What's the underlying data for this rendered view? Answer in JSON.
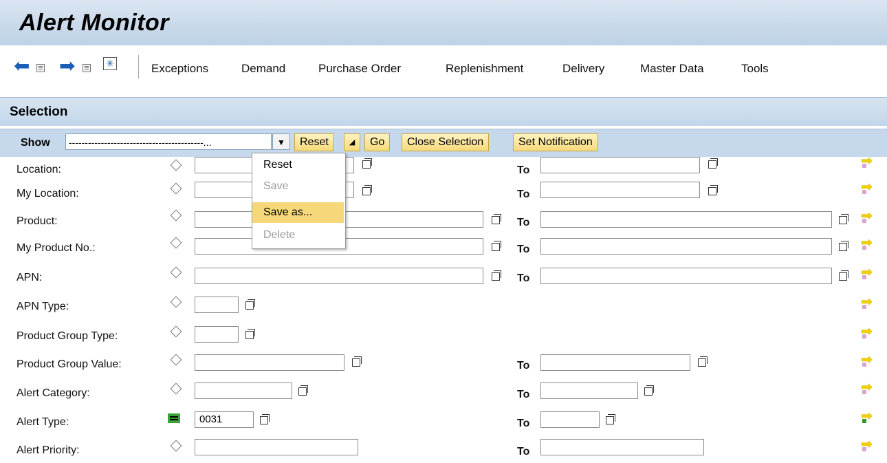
{
  "app": {
    "title": "Alert Monitor"
  },
  "nav": {
    "icons": [
      "back-arrow-icon",
      "history-list-icon",
      "forward-arrow-icon",
      "history-list-icon",
      "favorites-star-icon"
    ],
    "menu": [
      "Exceptions",
      "Demand",
      "Purchase Order",
      "Replenishment",
      "Delivery",
      "Master Data",
      "Tools"
    ]
  },
  "selection": {
    "title": "Selection",
    "show_label": "Show",
    "show_value": "------------------------------------------...",
    "buttons": {
      "reset": "Reset",
      "go": "Go",
      "close_selection": "Close Selection",
      "set_notification": "Set Notification"
    }
  },
  "context_menu": {
    "items": [
      {
        "label": "Reset",
        "enabled": true,
        "highlighted": false
      },
      {
        "label": "Save",
        "enabled": false,
        "highlighted": false
      },
      {
        "label": "Save as...",
        "enabled": true,
        "highlighted": true
      },
      {
        "label": "Delete",
        "enabled": false,
        "highlighted": false
      }
    ]
  },
  "to_label": "To",
  "rows": [
    {
      "label": "Location:",
      "value": "",
      "to_value": ""
    },
    {
      "label": "My Location:",
      "value": "",
      "to_value": ""
    },
    {
      "label": "Product:",
      "value": "",
      "to_value": ""
    },
    {
      "label": "My Product No.:",
      "value": "",
      "to_value": ""
    },
    {
      "label": "APN:",
      "value": "",
      "to_value": ""
    },
    {
      "label": "APN Type:",
      "value": ""
    },
    {
      "label": "Product Group Type:",
      "value": ""
    },
    {
      "label": "Product Group Value:",
      "value": "",
      "to_value": ""
    },
    {
      "label": "Alert Category:",
      "value": "",
      "to_value": ""
    },
    {
      "label": "Alert Type:",
      "value": "0031",
      "to_value": ""
    },
    {
      "label": "Alert Priority:",
      "value": "",
      "to_value": ""
    }
  ],
  "colors": {
    "header_bg": "#c9d9ea",
    "button_bg": "#f5d97a",
    "menu_highlight": "#f6d77a",
    "equal_icon": "#3aa335"
  }
}
